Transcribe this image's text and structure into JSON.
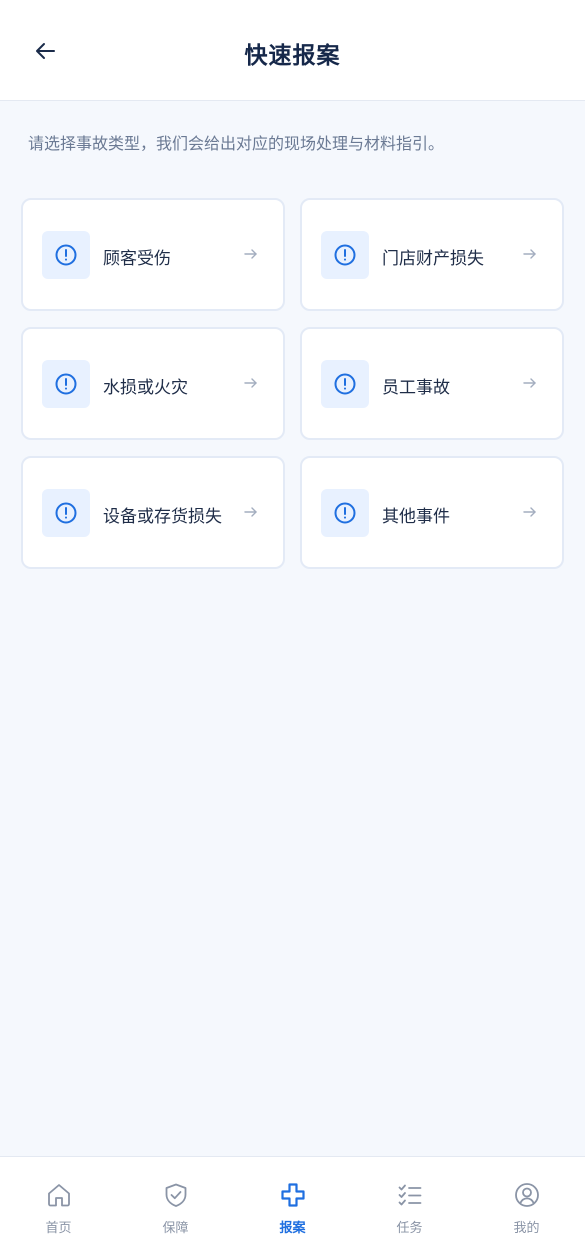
{
  "header": {
    "title": "快速报案"
  },
  "intro": {
    "text": "请选择事故类型，我们会给出对应的现场处理与材料指引。"
  },
  "categories": [
    {
      "label": "顾客受伤"
    },
    {
      "label": "门店财产损失"
    },
    {
      "label": "水损或火灾"
    },
    {
      "label": "员工事故"
    },
    {
      "label": "设备或存货损失"
    },
    {
      "label": "其他事件"
    }
  ],
  "tabbar": {
    "tabs": [
      {
        "label": "首页",
        "icon": "home-icon",
        "active": false
      },
      {
        "label": "保障",
        "icon": "shield-check-icon",
        "active": false
      },
      {
        "label": "报案",
        "icon": "plus-cross-icon",
        "active": true
      },
      {
        "label": "任务",
        "icon": "checklist-icon",
        "active": false
      },
      {
        "label": "我的",
        "icon": "user-circle-icon",
        "active": false
      }
    ]
  },
  "colors": {
    "accent": "#1f6fe0",
    "icon_bg": "#e8f1ff",
    "page_bg": "#f5f8fd",
    "inactive": "#8a94a6"
  }
}
